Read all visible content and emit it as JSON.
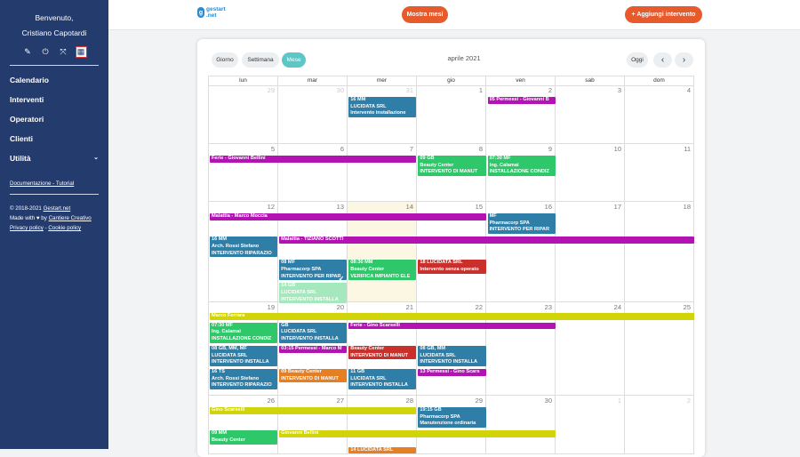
{
  "sidebar": {
    "welcome": "Benvenuto,",
    "user": "Cristiano Capotardi",
    "icons": [
      {
        "name": "edit-icon",
        "glyph": "✎"
      },
      {
        "name": "power-icon",
        "glyph": "⏻"
      },
      {
        "name": "fullscreen-icon",
        "glyph": "⤧"
      },
      {
        "name": "layout-icon",
        "glyph": "▦"
      }
    ],
    "nav": [
      "Calendario",
      "Interventi",
      "Operatori",
      "Clienti"
    ],
    "utility": "Utilità",
    "doc_link": "Documentazione",
    "tutorial_link": "Tutorial",
    "copyright": "© 2018-2021 ",
    "copyright_link": "Gestart.net",
    "made_with": "Made with ♥ by ",
    "made_by": "Cantiere Creativo",
    "privacy": "Privacy policy",
    "cookie": "Cookie policy"
  },
  "header": {
    "logo_letter": "g",
    "logo_top": "gestart",
    "logo_bottom": ".net",
    "show_months": "Mostra mesi",
    "add_intervention": "+ Aggiungi intervento"
  },
  "calendar": {
    "views": [
      "Giorno",
      "Settimana",
      "Mese"
    ],
    "active_view": "Mese",
    "title": "aprile 2021",
    "today_btn": "Oggi",
    "prev": "‹",
    "next": "›",
    "dow": [
      "lun",
      "mar",
      "mer",
      "gio",
      "ven",
      "sab",
      "dom"
    ],
    "weeks": [
      {
        "days": [
          {
            "n": "29",
            "o": true
          },
          {
            "n": "30",
            "o": true
          },
          {
            "n": "31",
            "o": true
          },
          {
            "n": "1"
          },
          {
            "n": "2"
          },
          {
            "n": "3"
          },
          {
            "n": "4"
          }
        ],
        "events": [
          {
            "c": 2,
            "s": 1,
            "r": 0,
            "lines": [
              "16 MM",
              "LUCIDATA SRL",
              "Intervento installazione"
            ],
            "color": "#2e7ea8"
          },
          {
            "c": 4,
            "s": 1,
            "r": 0,
            "lines": [
              "05 Permessi - Giovanni B"
            ],
            "color": "#b313b3"
          }
        ]
      },
      {
        "days": [
          {
            "n": "5"
          },
          {
            "n": "6"
          },
          {
            "n": "7"
          },
          {
            "n": "8"
          },
          {
            "n": "9"
          },
          {
            "n": "10"
          },
          {
            "n": "11"
          }
        ],
        "events": [
          {
            "c": 0,
            "s": 3,
            "r": 0,
            "lines": [
              "Ferie - Giovanni Bellini"
            ],
            "color": "#b313b3"
          },
          {
            "c": 3,
            "s": 1,
            "r": 0,
            "lines": [
              "09 GB",
              "Beauty Center",
              "INTERVENTO DI MANUT"
            ],
            "color": "#2ec76a"
          },
          {
            "c": 4,
            "s": 1,
            "r": 0,
            "lines": [
              "07:30 MF",
              "Ing. Calamai",
              "INSTALLAZIONE CONDIZ"
            ],
            "color": "#2ec76a"
          }
        ]
      },
      {
        "days": [
          {
            "n": "12"
          },
          {
            "n": "13"
          },
          {
            "n": "14",
            "t": true
          },
          {
            "n": "15"
          },
          {
            "n": "16"
          },
          {
            "n": "17"
          },
          {
            "n": "18"
          }
        ],
        "events": [
          {
            "c": 0,
            "s": 4,
            "r": 0,
            "lines": [
              "Malattia - Marco Moccia"
            ],
            "color": "#b313b3"
          },
          {
            "c": 4,
            "s": 1,
            "r": 0,
            "lines": [
              "MF",
              "Pharmacorp SPA",
              "INTERVENTO PER RIPAR"
            ],
            "color": "#2e7ea8"
          },
          {
            "c": 0,
            "s": 1,
            "r": 1,
            "lines": [
              "16 MM",
              "Arch. Rossi Stefano",
              "INTERVENTO RIPARAZIO"
            ],
            "color": "#2e7ea8"
          },
          {
            "c": 1,
            "s": 6,
            "r": 1,
            "lines": [
              "Malattia - TIZIANO SCOTTI"
            ],
            "color": "#b313b3"
          },
          {
            "c": 1,
            "s": 1,
            "r": 2,
            "lines": [
              "08 MF",
              "Pharmacorp SPA",
              "INTERVENTO PER RIPAR"
            ],
            "color": "#2e7ea8"
          },
          {
            "c": 2,
            "s": 1,
            "r": 2,
            "lines": [
              "08:30 MM",
              "Beauty Center",
              "VERIFICA IMPIANTO ELE"
            ],
            "color": "#2ec76a"
          },
          {
            "c": 3,
            "s": 1,
            "r": 2,
            "lines": [
              "18 LUCIDATA SRL",
              "Intervento senza operato"
            ],
            "color": "#c9302c"
          },
          {
            "c": 1,
            "s": 1,
            "r": 3,
            "lines": [
              "14 GB",
              "LUCIDATA SRL",
              "INTERVENTO INSTALLA"
            ],
            "color": "#a6e8bd",
            "done": true
          }
        ]
      },
      {
        "days": [
          {
            "n": "19"
          },
          {
            "n": "20"
          },
          {
            "n": "21"
          },
          {
            "n": "22"
          },
          {
            "n": "23"
          },
          {
            "n": "24"
          },
          {
            "n": "25"
          }
        ],
        "events": [
          {
            "c": 0,
            "s": 7,
            "r": 0,
            "lines": [
              "Marco Ferrara"
            ],
            "color": "#d2d40a"
          },
          {
            "c": 0,
            "s": 1,
            "r": 1,
            "lines": [
              "07:30 MF",
              "Ing. Calamai",
              "INSTALLAZIONE CONDIZ"
            ],
            "color": "#2ec76a"
          },
          {
            "c": 1,
            "s": 1,
            "r": 1,
            "lines": [
              "GB",
              "LUCIDATA SRL",
              "INTERVENTO INSTALLA"
            ],
            "color": "#2e7ea8"
          },
          {
            "c": 2,
            "s": 3,
            "r": 1,
            "lines": [
              "Ferie - Gino Scarselli"
            ],
            "color": "#b313b3"
          },
          {
            "c": 0,
            "s": 1,
            "r": 2,
            "lines": [
              "08 GB, MM, MF",
              "LUCIDATA SRL",
              "INTERVENTO INSTALLA"
            ],
            "color": "#2e7ea8"
          },
          {
            "c": 1,
            "s": 1,
            "r": 2,
            "lines": [
              "03:15 Permessi - Marco M"
            ],
            "color": "#b313b3"
          },
          {
            "c": 2,
            "s": 1,
            "r": 2,
            "lines": [
              "Beauty Center",
              "INTERVENTO DI MANUT"
            ],
            "color": "#c9302c"
          },
          {
            "c": 3,
            "s": 1,
            "r": 2,
            "lines": [
              "08 GB, MM",
              "LUCIDATA SRL",
              "INTERVENTO INSTALLA"
            ],
            "color": "#2e7ea8"
          },
          {
            "c": 0,
            "s": 1,
            "r": 3,
            "lines": [
              "16 TS",
              "Arch. Rossi Stefano",
              "INTERVENTO RIPARAZIO"
            ],
            "color": "#2e7ea8"
          },
          {
            "c": 1,
            "s": 1,
            "r": 3,
            "lines": [
              "09 Beauty Center",
              "INTERVENTO DI MANUT"
            ],
            "color": "#e67e22"
          },
          {
            "c": 2,
            "s": 1,
            "r": 3,
            "lines": [
              "11 GB",
              "LUCIDATA SRL",
              "INTERVENTO INSTALLA"
            ],
            "color": "#2e7ea8"
          },
          {
            "c": 3,
            "s": 1,
            "r": 3,
            "lines": [
              "13 Permessi - Gino Scars"
            ],
            "color": "#b313b3"
          }
        ]
      },
      {
        "days": [
          {
            "n": "26"
          },
          {
            "n": "27"
          },
          {
            "n": "28"
          },
          {
            "n": "29"
          },
          {
            "n": "30"
          },
          {
            "n": "1",
            "o": true
          },
          {
            "n": "2",
            "o": true
          }
        ],
        "events": [
          {
            "c": 0,
            "s": 3,
            "r": 0,
            "lines": [
              "Gino Scarselli"
            ],
            "color": "#d2d40a"
          },
          {
            "c": 3,
            "s": 1,
            "r": 0,
            "lines": [
              "19:15 GB",
              "Pharmacorp SPA",
              "Manutenzione ordinaria"
            ],
            "color": "#2e7ea8"
          },
          {
            "c": 0,
            "s": 1,
            "r": 1,
            "lines": [
              "09 MM",
              "Beauty Center"
            ],
            "color": "#2ec76a"
          },
          {
            "c": 1,
            "s": 4,
            "r": 1,
            "lines": [
              "Giovanni Bellini"
            ],
            "color": "#d2d40a"
          },
          {
            "c": 2,
            "s": 1,
            "r": 2,
            "lines": [
              "14 LUCIDATA SRL"
            ],
            "color": "#e67e22"
          }
        ]
      }
    ]
  }
}
